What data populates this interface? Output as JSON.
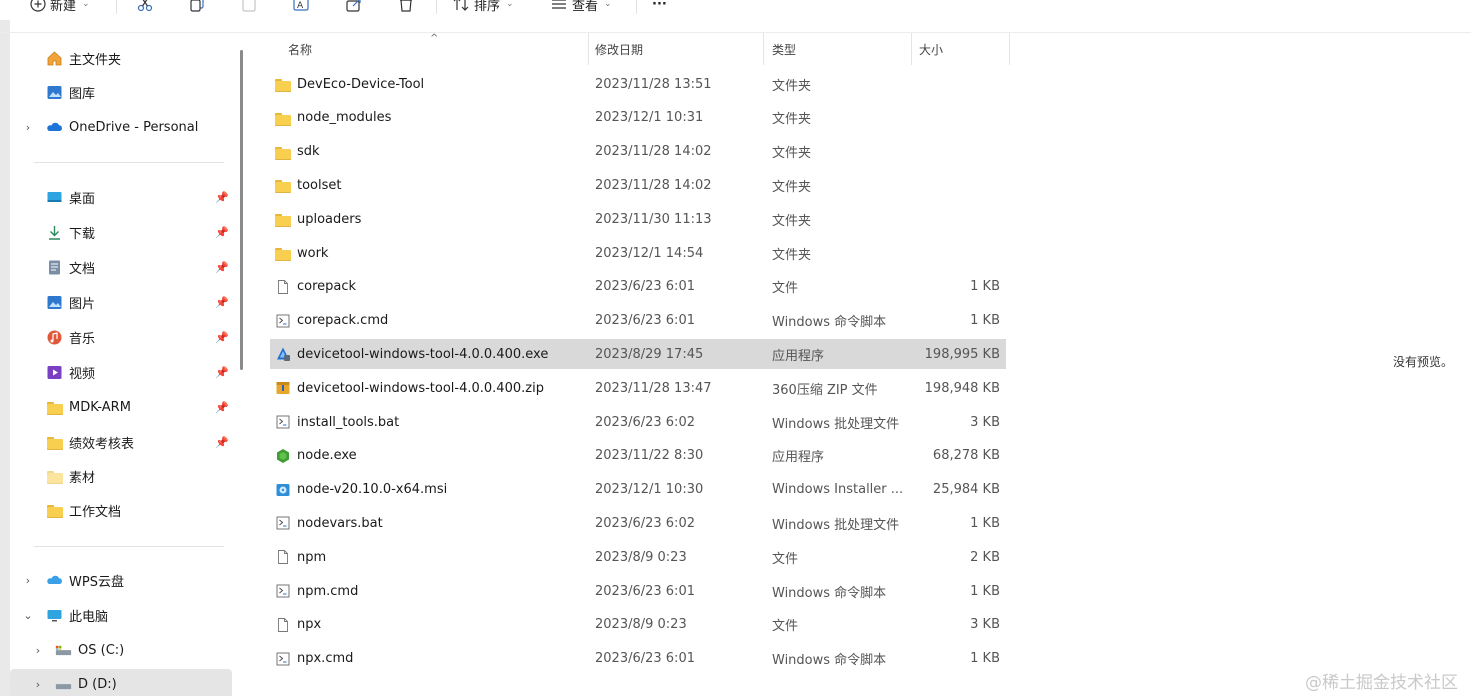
{
  "toolbar": {
    "new_label": "新建",
    "sort_label": "排序",
    "view_label": "查看",
    "more_label": "···"
  },
  "sidebar": {
    "items": [
      {
        "label": "主文件夹",
        "icon": "home-icon"
      },
      {
        "label": "图库",
        "icon": "gallery-icon"
      },
      {
        "label": "OneDrive - Personal",
        "icon": "onedrive-cloud-icon",
        "chevron": "›"
      },
      {
        "label": "桌面",
        "icon": "desktop-icon",
        "pin": "📌"
      },
      {
        "label": "下载",
        "icon": "download-icon",
        "pin": "📌"
      },
      {
        "label": "文档",
        "icon": "documents-icon",
        "pin": "📌"
      },
      {
        "label": "图片",
        "icon": "pictures-icon",
        "pin": "📌"
      },
      {
        "label": "音乐",
        "icon": "music-icon",
        "pin": "📌"
      },
      {
        "label": "视频",
        "icon": "videos-icon",
        "pin": "📌"
      },
      {
        "label": "MDK-ARM",
        "icon": "folder-icon",
        "pin": "📌"
      },
      {
        "label": "绩效考核表",
        "icon": "folder-icon",
        "pin": "📌"
      },
      {
        "label": "素材",
        "icon": "folder-icon"
      },
      {
        "label": "工作文档",
        "icon": "folder-icon"
      },
      {
        "label": "WPS云盘",
        "icon": "wps-cloud-icon",
        "chevron": "›"
      },
      {
        "label": "此电脑",
        "icon": "this-pc-icon",
        "chevron": "⌄"
      },
      {
        "label": "OS (C:)",
        "icon": "drive-c-icon",
        "chevron": "›"
      },
      {
        "label": "D (D:)",
        "icon": "drive-d-icon",
        "chevron": "›"
      }
    ]
  },
  "columns": {
    "name": "名称",
    "date": "修改日期",
    "type": "类型",
    "size": "大小"
  },
  "files": [
    {
      "name": "DevEco-Device-Tool",
      "date": "2023/11/28 13:51",
      "type": "文件夹",
      "size": "",
      "icon": "folder-icon"
    },
    {
      "name": "node_modules",
      "date": "2023/12/1 10:31",
      "type": "文件夹",
      "size": "",
      "icon": "folder-icon"
    },
    {
      "name": "sdk",
      "date": "2023/11/28 14:02",
      "type": "文件夹",
      "size": "",
      "icon": "folder-icon"
    },
    {
      "name": "toolset",
      "date": "2023/11/28 14:02",
      "type": "文件夹",
      "size": "",
      "icon": "folder-icon"
    },
    {
      "name": "uploaders",
      "date": "2023/11/30 11:13",
      "type": "文件夹",
      "size": "",
      "icon": "folder-icon"
    },
    {
      "name": "work",
      "date": "2023/12/1 14:54",
      "type": "文件夹",
      "size": "",
      "icon": "folder-icon"
    },
    {
      "name": "corepack",
      "date": "2023/6/23 6:01",
      "type": "文件",
      "size": "1 KB",
      "icon": "file-icon"
    },
    {
      "name": "corepack.cmd",
      "date": "2023/6/23 6:01",
      "type": "Windows 命令脚本",
      "size": "1 KB",
      "icon": "script-file-icon"
    },
    {
      "name": "devicetool-windows-tool-4.0.0.400.exe",
      "date": "2023/8/29 17:45",
      "type": "应用程序",
      "size": "198,995 KB",
      "icon": "installer-exe-icon",
      "selected": true
    },
    {
      "name": "devicetool-windows-tool-4.0.0.400.zip",
      "date": "2023/11/28 13:47",
      "type": "360压缩 ZIP 文件",
      "size": "198,948 KB",
      "icon": "zip-archive-icon"
    },
    {
      "name": "install_tools.bat",
      "date": "2023/6/23 6:02",
      "type": "Windows 批处理文件",
      "size": "3 KB",
      "icon": "script-file-icon"
    },
    {
      "name": "node.exe",
      "date": "2023/11/22 8:30",
      "type": "应用程序",
      "size": "68,278 KB",
      "icon": "nodejs-icon"
    },
    {
      "name": "node-v20.10.0-x64.msi",
      "date": "2023/12/1 10:30",
      "type": "Windows Installer ...",
      "size": "25,984 KB",
      "icon": "msi-installer-icon"
    },
    {
      "name": "nodevars.bat",
      "date": "2023/6/23 6:02",
      "type": "Windows 批处理文件",
      "size": "1 KB",
      "icon": "script-file-icon"
    },
    {
      "name": "npm",
      "date": "2023/8/9 0:23",
      "type": "文件",
      "size": "2 KB",
      "icon": "file-icon"
    },
    {
      "name": "npm.cmd",
      "date": "2023/6/23 6:01",
      "type": "Windows 命令脚本",
      "size": "1 KB",
      "icon": "script-file-icon"
    },
    {
      "name": "npx",
      "date": "2023/8/9 0:23",
      "type": "文件",
      "size": "3 KB",
      "icon": "file-icon"
    },
    {
      "name": "npx.cmd",
      "date": "2023/6/23 6:01",
      "type": "Windows 命令脚本",
      "size": "1 KB",
      "icon": "script-file-icon"
    }
  ],
  "preview": {
    "text": "没有预览。"
  },
  "watermark": "@稀土掘金技术社区"
}
